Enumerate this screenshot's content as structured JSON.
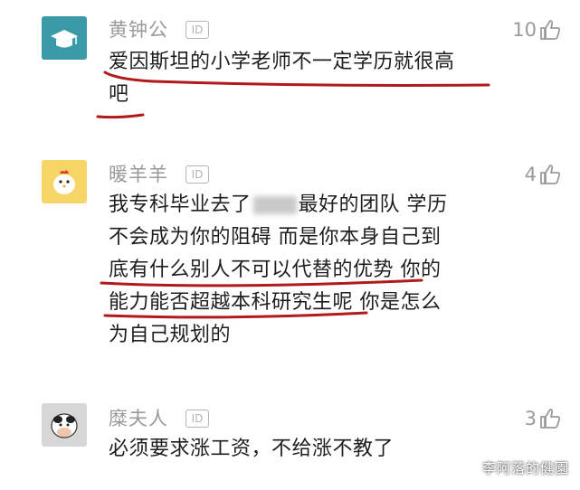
{
  "comments": [
    {
      "username": "黄钟公",
      "id_badge": "ID",
      "likes": "10",
      "lines": [
        "爱因斯坦的小学老师不一定学历就很高",
        "吧"
      ],
      "avatar_icon": "graduation-cap-icon",
      "avatar_color": "#3a9aa8"
    },
    {
      "username": "暖羊羊",
      "id_badge": "ID",
      "likes": "4",
      "line1_a": "我专科毕业去了",
      "line1_b": "最好的团队 学历",
      "lines": [
        "不会成为你的阻碍 而是你本身自己到",
        "底有什么别人不可以代替的优势 你的",
        "能力能否超越本科研究生呢 你是怎么",
        "为自己规划的"
      ],
      "avatar_icon": "chicken-icon",
      "avatar_color": "#f6d567"
    },
    {
      "username": "糜夫人",
      "id_badge": "ID",
      "likes": "3",
      "lines": [
        "必须要求涨工资，不给涨不教了"
      ],
      "avatar_icon": "cow-icon",
      "avatar_color": "#d7d7d7"
    }
  ],
  "watermark": "李阿落的健園",
  "colors": {
    "underline": "#b01a1a",
    "text": "#1e1e1e",
    "muted": "#9a9a9a"
  }
}
